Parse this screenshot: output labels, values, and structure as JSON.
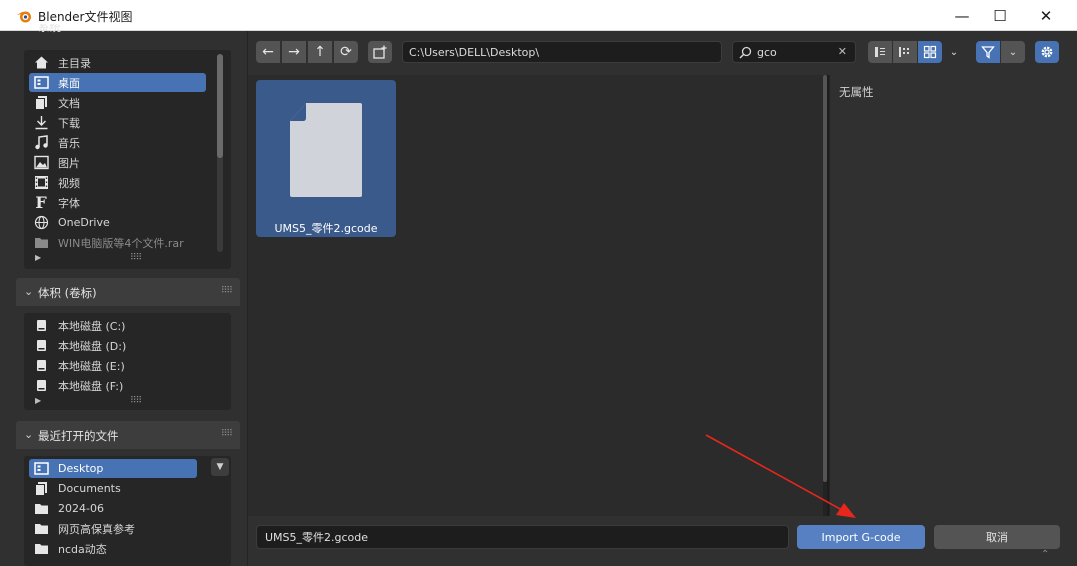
{
  "window": {
    "title": "Blender文件视图",
    "minimize": "—",
    "maximize": "☐",
    "close": "✕"
  },
  "sidebar": {
    "system_header": "系统",
    "system_items": [
      {
        "label": "主目录",
        "icon": "home-icon",
        "selected": false
      },
      {
        "label": "桌面",
        "icon": "desktop-icon",
        "selected": true
      },
      {
        "label": "文档",
        "icon": "documents-icon",
        "selected": false
      },
      {
        "label": "下载",
        "icon": "download-icon",
        "selected": false
      },
      {
        "label": "音乐",
        "icon": "music-icon",
        "selected": false
      },
      {
        "label": "图片",
        "icon": "image-icon",
        "selected": false
      },
      {
        "label": "视频",
        "icon": "video-icon",
        "selected": false
      },
      {
        "label": "字体",
        "icon": "font-icon",
        "selected": false
      },
      {
        "label": "OneDrive",
        "icon": "globe-icon",
        "selected": false
      },
      {
        "label": "WIN电脑版等4个文件.rar",
        "icon": "folder-icon",
        "selected": false
      }
    ],
    "volumes_header": "体积 (卷标)",
    "volumes": [
      {
        "label": "本地磁盘 (C:)",
        "icon": "disk-icon"
      },
      {
        "label": "本地磁盘 (D:)",
        "icon": "disk-icon"
      },
      {
        "label": "本地磁盘 (E:)",
        "icon": "disk-icon"
      },
      {
        "label": "本地磁盘 (F:)",
        "icon": "disk-icon"
      }
    ],
    "recent_header": "最近打开的文件",
    "recent": [
      {
        "label": "Desktop",
        "icon": "desktop-icon",
        "selected": true
      },
      {
        "label": "Documents",
        "icon": "documents-icon",
        "selected": false
      },
      {
        "label": "2024-06",
        "icon": "folder-icon",
        "selected": false
      },
      {
        "label": "网页高保真参考",
        "icon": "folder-icon",
        "selected": false
      },
      {
        "label": "ncda动态",
        "icon": "folder-icon",
        "selected": false
      }
    ]
  },
  "toolbar": {
    "back": "←",
    "forward": "→",
    "parent": "↑",
    "refresh": "⟳",
    "path": "C:\\Users\\DELL\\Desktop\\",
    "search_value": "gco",
    "search_clear": "✕"
  },
  "files": [
    {
      "name": "UMS5_零件2.gcode",
      "icon": "file-icon",
      "selected": true
    }
  ],
  "properties": {
    "empty_text": "无属性"
  },
  "footer": {
    "filename": "UMS5_零件2.gcode",
    "import_label": "Import G-code",
    "cancel_label": "取消"
  },
  "colors": {
    "accent": "#4772b3",
    "annotation_arrow": "#e8261c"
  }
}
